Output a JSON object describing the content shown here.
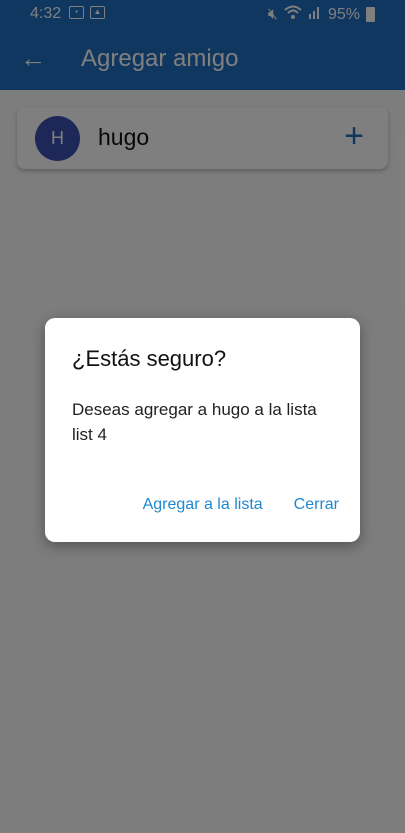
{
  "status_bar": {
    "time": "4:32",
    "battery": "95%",
    "icons": [
      "photo-icon",
      "image-icon",
      "mute-icon",
      "wifi-icon",
      "signal-icon",
      "battery-icon"
    ]
  },
  "app_bar": {
    "title": "Agregar amigo",
    "color": "#1f6fbf"
  },
  "friend": {
    "initial": "H",
    "name": "hugo",
    "avatar_color": "#3a4fb0"
  },
  "dialog": {
    "title": "¿Estás seguro?",
    "message": "Deseas agregar a hugo a la lista list 4",
    "confirm_label": "Agregar a la lista",
    "cancel_label": "Cerrar",
    "action_color": "#1e88d0"
  }
}
